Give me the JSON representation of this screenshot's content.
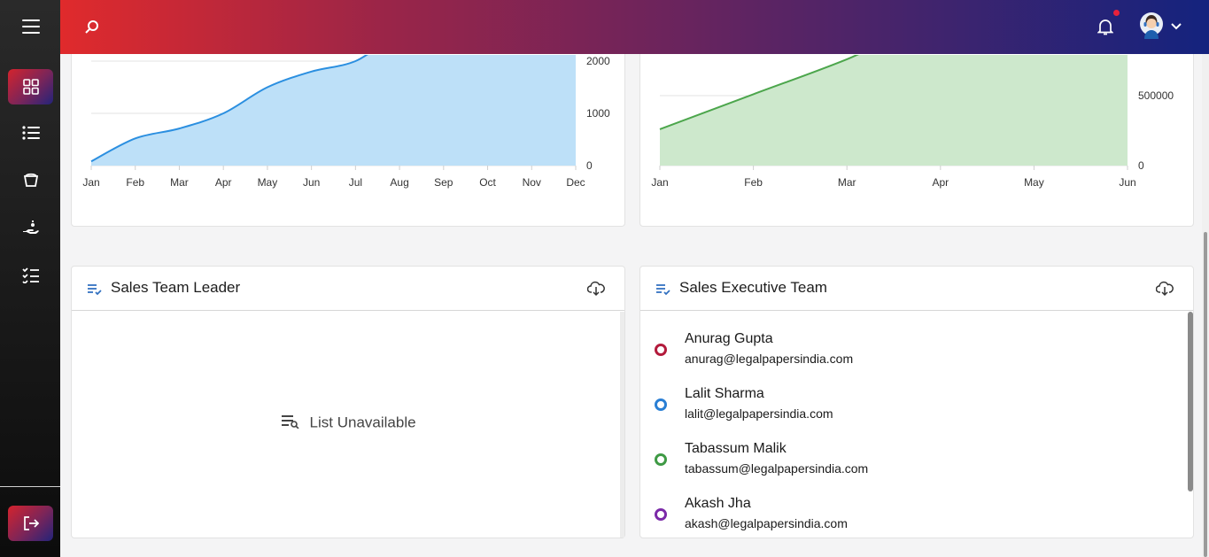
{
  "colors": {
    "accent_red": "#d4232d",
    "accent_navy": "#14237e",
    "chart1_line": "#2b8fe0",
    "chart1_fill": "#bde0f8",
    "chart2_line": "#4ca64c",
    "chart2_fill": "#cde8cc",
    "status_red": "#b31b3c",
    "status_blue": "#2a7fd4",
    "status_green": "#3f9a45",
    "status_purple": "#7b2aa8"
  },
  "sidebar": {
    "icons": [
      "menu-icon",
      "dashboard-icon",
      "list-icon",
      "cup-icon",
      "hand-coin-icon",
      "checklist-icon",
      "logout-icon"
    ]
  },
  "header": {
    "icons": [
      "search-icon",
      "bell-icon",
      "avatar",
      "chevron-down-icon"
    ]
  },
  "chart_data": [
    {
      "type": "area",
      "x": [
        "Jan",
        "Feb",
        "Mar",
        "Apr",
        "May",
        "Jun",
        "Jul",
        "Aug",
        "Sep",
        "Oct",
        "Nov",
        "Dec"
      ],
      "series": [
        {
          "values": [
            80,
            520,
            710,
            1000,
            1500,
            1800,
            2000,
            2500,
            2500,
            2500,
            2500,
            2500
          ]
        }
      ],
      "y_ticks": [
        "0",
        "1000",
        "2000"
      ],
      "ylim": [
        0,
        2000
      ],
      "grid": true,
      "y_axis_side": "right"
    },
    {
      "type": "area",
      "x": [
        "Jan",
        "Feb",
        "Mar",
        "Apr",
        "May",
        "Jun"
      ],
      "series": [
        {
          "values": [
            260000,
            510000,
            760000,
            1050000,
            1050000,
            1050000
          ]
        }
      ],
      "y_ticks": [
        "0",
        "500000"
      ],
      "ylim": [
        0,
        500000
      ],
      "grid": true,
      "y_axis_side": "right"
    }
  ],
  "leaders_panel": {
    "title": "Sales Team Leader",
    "empty_text": "List Unavailable"
  },
  "executives_panel": {
    "title": "Sales Executive Team",
    "members": [
      {
        "name": "Anurag Gupta",
        "email": "anurag@legalpapersindia.com",
        "color": "#b31b3c"
      },
      {
        "name": "Lalit Sharma",
        "email": "lalit@legalpapersindia.com",
        "color": "#2a7fd4"
      },
      {
        "name": "Tabassum Malik",
        "email": "tabassum@legalpapersindia.com",
        "color": "#3f9a45"
      },
      {
        "name": "Akash Jha",
        "email": "akash@legalpapersindia.com",
        "color": "#7b2aa8"
      }
    ]
  }
}
